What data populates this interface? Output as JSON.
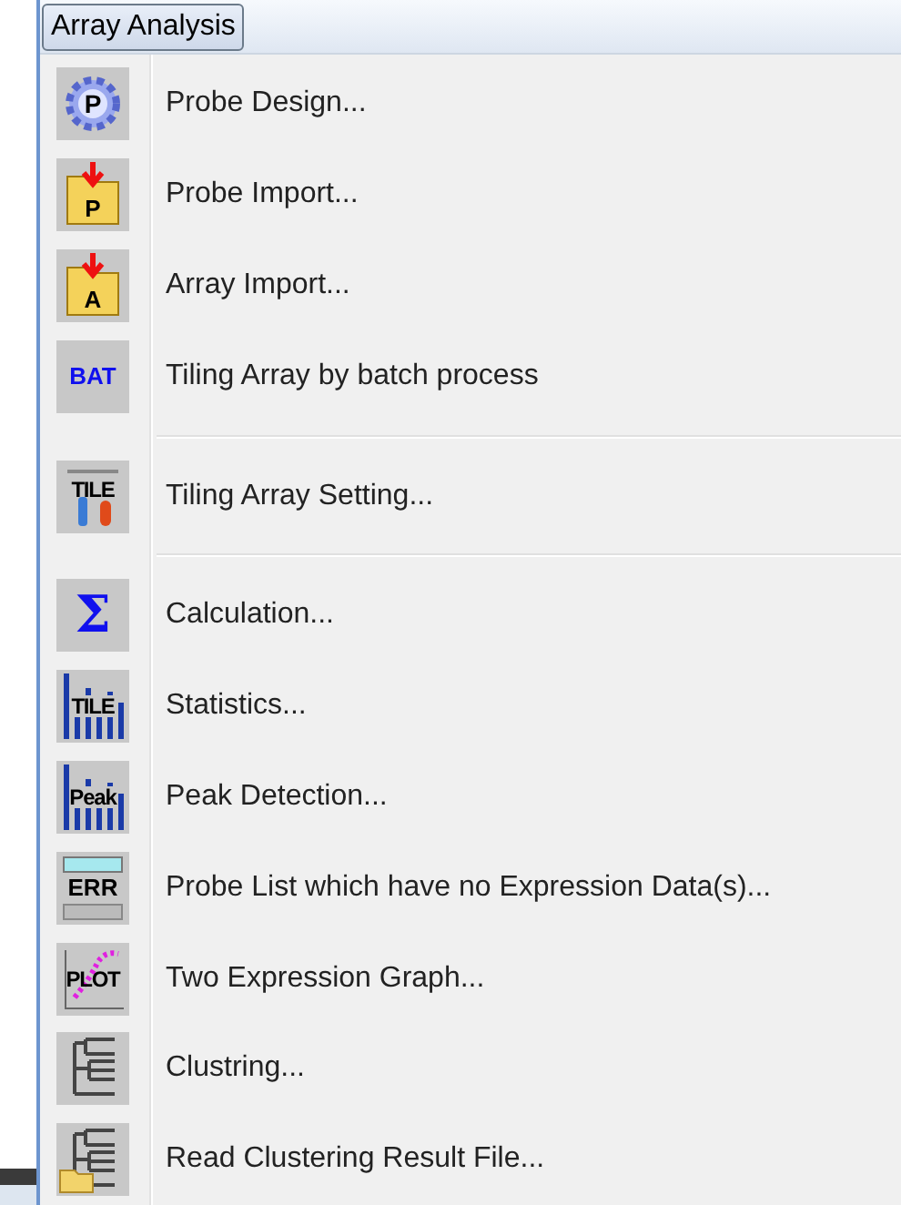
{
  "menu_bar": {
    "title": "Array Analysis",
    "selected": true
  },
  "menu": {
    "items": [
      {
        "kind": "item",
        "icon_text": "P",
        "label": "Probe Design..."
      },
      {
        "kind": "item",
        "icon_text": "P",
        "label": "Probe Import..."
      },
      {
        "kind": "item",
        "icon_text": "A",
        "label": "Array Import..."
      },
      {
        "kind": "item",
        "icon_text": "BAT",
        "label": "Tiling Array by batch process"
      },
      {
        "kind": "separator"
      },
      {
        "kind": "item",
        "icon_text": "TILE",
        "label": "Tiling Array Setting..."
      },
      {
        "kind": "separator"
      },
      {
        "kind": "item",
        "icon_text": "Σ",
        "label": "Calculation..."
      },
      {
        "kind": "item",
        "icon_text": "TILE",
        "label": "Statistics..."
      },
      {
        "kind": "item",
        "icon_text": "Peak",
        "label": "Peak Detection..."
      },
      {
        "kind": "item",
        "icon_text": "ERR",
        "label": "Probe List which have no Expression Data(s)..."
      },
      {
        "kind": "item",
        "icon_text": "PLOT",
        "label": "Two Expression Graph..."
      },
      {
        "kind": "item",
        "label": "Clustring..."
      },
      {
        "kind": "item",
        "label": "Read Clustering Result File..."
      }
    ]
  }
}
